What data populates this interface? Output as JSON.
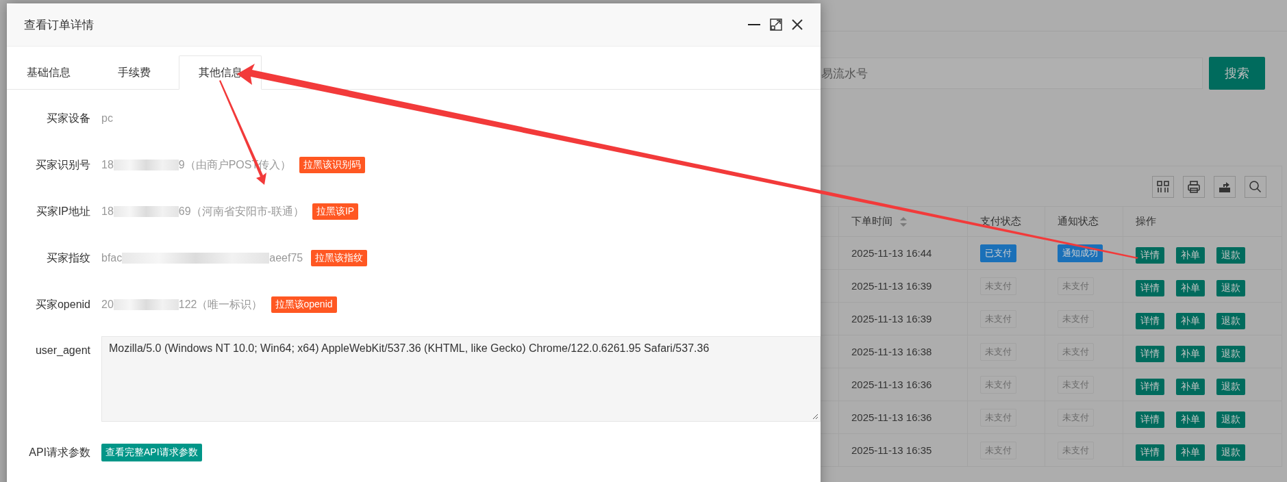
{
  "window": {
    "title": "查看订单详情"
  },
  "tabs": [
    {
      "label": "基础信息",
      "selected": false
    },
    {
      "label": "手续费",
      "selected": false
    },
    {
      "label": "其他信息",
      "selected": true
    }
  ],
  "fields": [
    {
      "kind": "text",
      "label": "买家设备",
      "value": "pc"
    },
    {
      "kind": "redacted",
      "label": "买家识别号",
      "value_start": "18",
      "value_end": "9（由商户POST传入）",
      "action": "拉黑该识别码"
    },
    {
      "kind": "redacted",
      "label": "买家IP地址",
      "value_start": "18",
      "value_end": "69（河南省安阳市-联通）",
      "action": "拉黑该IP"
    },
    {
      "kind": "redacted",
      "label": "买家指纹",
      "value_start": "bfac",
      "value_end": "aeef75",
      "action": "拉黑该指纹"
    },
    {
      "kind": "redacted",
      "label": "买家openid",
      "value_start": "20",
      "value_end": "122（唯一标识）",
      "action": "拉黑该openid"
    },
    {
      "kind": "textarea",
      "label": "user_agent",
      "value": "Mozilla/5.0 (Windows NT 10.0; Win64; x64) AppleWebKit/537.36 (KHTML, like Gecko) Chrome/122.0.6261.95 Safari/537.36"
    },
    {
      "kind": "button",
      "label": "API请求参数",
      "action": "查看完整API请求参数"
    }
  ],
  "background": {
    "search": {
      "placeholder": "易流水号"
    },
    "search_button": "搜索",
    "table": {
      "columns": [
        {
          "label": "下单时间",
          "sortable": true
        },
        {
          "label": "支付状态",
          "sortable": false
        },
        {
          "label": "通知状态",
          "sortable": false
        },
        {
          "label": "操作",
          "sortable": false
        }
      ],
      "rows": [
        {
          "time": "2025-11-13 16:44",
          "pay_status": {
            "text": "已支付",
            "done": true
          },
          "notify_status": {
            "text": "通知成功",
            "done": true
          },
          "actions": [
            "详情",
            "补单",
            "退款"
          ]
        },
        {
          "time": "2025-11-13 16:39",
          "pay_status": {
            "text": "未支付",
            "done": false
          },
          "notify_status": {
            "text": "未支付",
            "done": false
          },
          "actions": [
            "详情",
            "补单",
            "退款"
          ]
        },
        {
          "time": "2025-11-13 16:39",
          "pay_status": {
            "text": "未支付",
            "done": false
          },
          "notify_status": {
            "text": "未支付",
            "done": false
          },
          "actions": [
            "详情",
            "补单",
            "退款"
          ]
        },
        {
          "time": "2025-11-13 16:38",
          "pay_status": {
            "text": "未支付",
            "done": false
          },
          "notify_status": {
            "text": "未支付",
            "done": false
          },
          "actions": [
            "详情",
            "补单",
            "退款"
          ]
        },
        {
          "time": "2025-11-13 16:36",
          "pay_status": {
            "text": "未支付",
            "done": false
          },
          "notify_status": {
            "text": "未支付",
            "done": false
          },
          "actions": [
            "详情",
            "补单",
            "退款"
          ]
        },
        {
          "time": "2025-11-13 16:36",
          "pay_status": {
            "text": "未支付",
            "done": false
          },
          "notify_status": {
            "text": "未支付",
            "done": false
          },
          "actions": [
            "详情",
            "补单",
            "退款"
          ]
        },
        {
          "time": "2025-11-13 16:35",
          "pay_status": {
            "text": "未支付",
            "done": false
          },
          "notify_status": {
            "text": "未支付",
            "done": false
          },
          "actions": [
            "详情",
            "补单",
            "退款"
          ]
        }
      ]
    }
  }
}
